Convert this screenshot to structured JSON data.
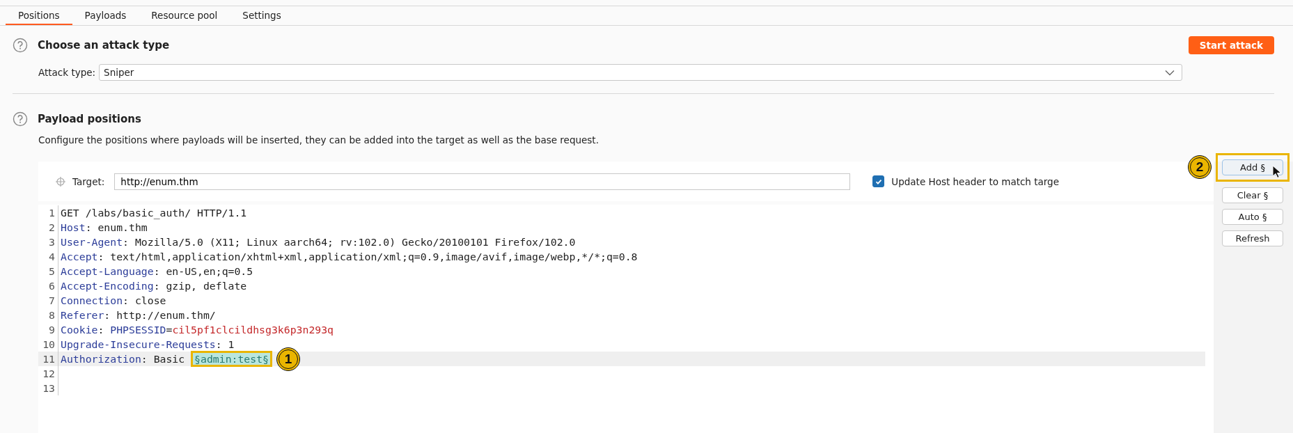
{
  "tabs": [
    {
      "label": "Positions",
      "selected": true
    },
    {
      "label": "Payloads",
      "selected": false
    },
    {
      "label": "Resource pool",
      "selected": false
    },
    {
      "label": "Settings",
      "selected": false
    }
  ],
  "attack_section": {
    "title": "Choose an attack type",
    "start_button": "Start attack",
    "field_label": "Attack type:",
    "value": "Sniper"
  },
  "positions_section": {
    "title": "Payload positions",
    "description": "Configure the positions where payloads will be inserted, they can be added into the target as well as the base request.",
    "target_label": "Target:",
    "target_value": "http://enum.thm",
    "update_host": {
      "label": "Update Host header to match targe",
      "checked": true
    }
  },
  "request_lines": [
    {
      "number": "1",
      "current": false,
      "segments": [
        {
          "kind": "plain",
          "text": "GET /labs/basic_auth/ HTTP/1.1"
        }
      ]
    },
    {
      "number": "2",
      "current": false,
      "segments": [
        {
          "kind": "name",
          "text": "Host"
        },
        {
          "kind": "plain",
          "text": ": enum.thm"
        }
      ]
    },
    {
      "number": "3",
      "current": false,
      "segments": [
        {
          "kind": "name",
          "text": "User-Agent"
        },
        {
          "kind": "plain",
          "text": ": Mozilla/5.0 (X11; Linux aarch64; rv:102.0) Gecko/20100101 Firefox/102.0"
        }
      ]
    },
    {
      "number": "4",
      "current": false,
      "segments": [
        {
          "kind": "name",
          "text": "Accept"
        },
        {
          "kind": "plain",
          "text": ": text/html,application/xhtml+xml,application/xml;q=0.9,image/avif,image/webp,*/*;q=0.8"
        }
      ]
    },
    {
      "number": "5",
      "current": false,
      "segments": [
        {
          "kind": "name",
          "text": "Accept-Language"
        },
        {
          "kind": "plain",
          "text": ": en-US,en;q=0.5"
        }
      ]
    },
    {
      "number": "6",
      "current": false,
      "segments": [
        {
          "kind": "name",
          "text": "Accept-Encoding"
        },
        {
          "kind": "plain",
          "text": ": gzip, deflate"
        }
      ]
    },
    {
      "number": "7",
      "current": false,
      "segments": [
        {
          "kind": "name",
          "text": "Connection"
        },
        {
          "kind": "plain",
          "text": ": close"
        }
      ]
    },
    {
      "number": "8",
      "current": false,
      "segments": [
        {
          "kind": "name",
          "text": "Referer"
        },
        {
          "kind": "plain",
          "text": ": http://enum.thm/"
        }
      ]
    },
    {
      "number": "9",
      "current": false,
      "segments": [
        {
          "kind": "name",
          "text": "Cookie"
        },
        {
          "kind": "plain",
          "text": ": "
        },
        {
          "kind": "name",
          "text": "PHPSESSID"
        },
        {
          "kind": "plain",
          "text": "="
        },
        {
          "kind": "cookie_value",
          "text": "cil5pf1clcildhsg3k6p3n293q"
        }
      ]
    },
    {
      "number": "10",
      "current": false,
      "segments": [
        {
          "kind": "name",
          "text": "Upgrade-Insecure-Requests"
        },
        {
          "kind": "plain",
          "text": ": 1"
        }
      ]
    },
    {
      "number": "11",
      "current": true,
      "segments": [
        {
          "kind": "name",
          "text": "Authorization"
        },
        {
          "kind": "plain",
          "text": ": Basic "
        },
        {
          "kind": "payload",
          "text": "§admin:test§",
          "callout": "1"
        }
      ]
    },
    {
      "number": "12",
      "current": false
    },
    {
      "number": "13",
      "current": false
    }
  ],
  "buttons": [
    {
      "label": "Add §",
      "hovered": true,
      "callout": "2"
    },
    {
      "label": "Clear §",
      "hovered": false
    },
    {
      "label": "Auto §",
      "hovered": false
    },
    {
      "label": "Refresh",
      "hovered": false
    }
  ]
}
